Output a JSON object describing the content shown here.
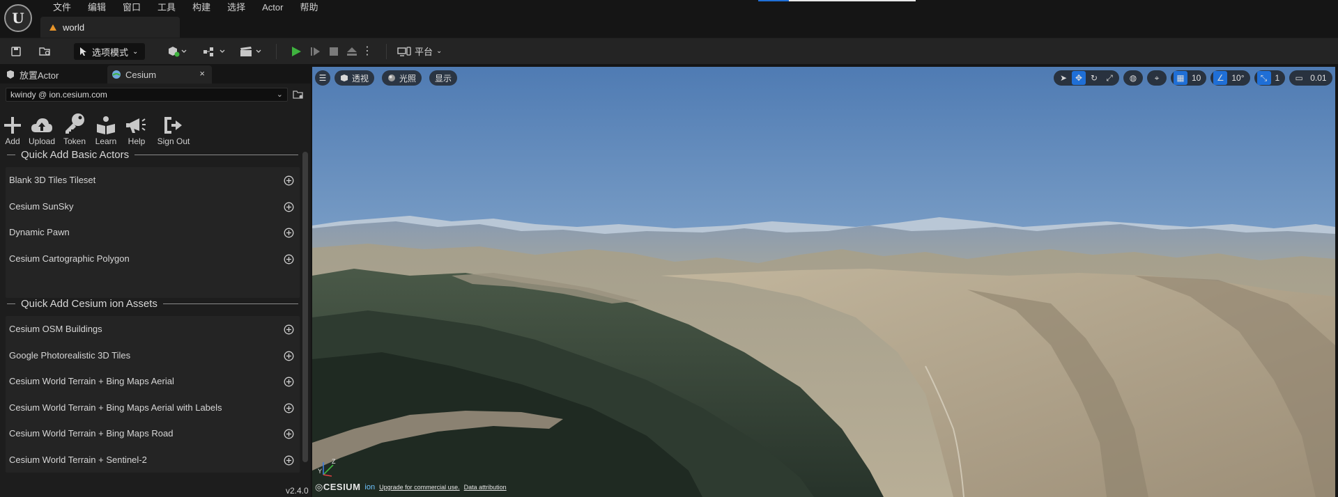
{
  "menu": {
    "items": [
      "文件",
      "编辑",
      "窗口",
      "工具",
      "构建",
      "选择",
      "Actor",
      "帮助"
    ]
  },
  "document_tab": {
    "title": "world"
  },
  "toolbar": {
    "mode_label": "选项模式",
    "platform_label": "平台"
  },
  "panel_tabs": {
    "place_actor": "放置Actor",
    "cesium": "Cesium",
    "close": "×"
  },
  "account": {
    "value": "kwindy @ ion.cesium.com"
  },
  "ion_buttons": [
    {
      "label": "Add",
      "icon": "plus-icon"
    },
    {
      "label": "Upload",
      "icon": "cloud-upload-icon"
    },
    {
      "label": "Token",
      "icon": "key-icon"
    },
    {
      "label": "Learn",
      "icon": "book-icon"
    },
    {
      "label": "Help",
      "icon": "megaphone-icon"
    },
    {
      "label": "Sign Out",
      "icon": "sign-out-icon"
    }
  ],
  "basic_actors": {
    "title": "Quick Add Basic Actors",
    "items": [
      "Blank 3D Tiles Tileset",
      "Cesium SunSky",
      "Dynamic Pawn",
      "Cesium Cartographic Polygon"
    ]
  },
  "ion_assets": {
    "title": "Quick Add Cesium ion Assets",
    "items": [
      "Cesium OSM Buildings",
      "Google Photorealistic 3D Tiles",
      "Cesium World Terrain + Bing Maps Aerial",
      "Cesium World Terrain + Bing Maps Aerial with Labels",
      "Cesium World Terrain + Bing Maps Road",
      "Cesium World Terrain + Sentinel-2"
    ]
  },
  "version": "v2.4.0",
  "viewport": {
    "perspective_label": "透视",
    "lit_label": "光照",
    "show_label": "显示",
    "grid_snap": "10",
    "rotation_snap": "10°",
    "scale_snap": "1",
    "camera_speed": "0.01",
    "credit_brand": "CESIUM",
    "credit_ion": "ion",
    "credit_upgrade": "Upgrade for commercial use.",
    "credit_data": "Data attribution",
    "axis_z": "Z",
    "axis_y": "Y"
  },
  "colors": {
    "accent": "#1f6fd6",
    "play_green": "#3fb33f",
    "panel_bg": "#1d1d1d",
    "list_bg": "#242424",
    "sky_top": "#4f7bb3",
    "sky_horizon": "#c3d3e0"
  }
}
